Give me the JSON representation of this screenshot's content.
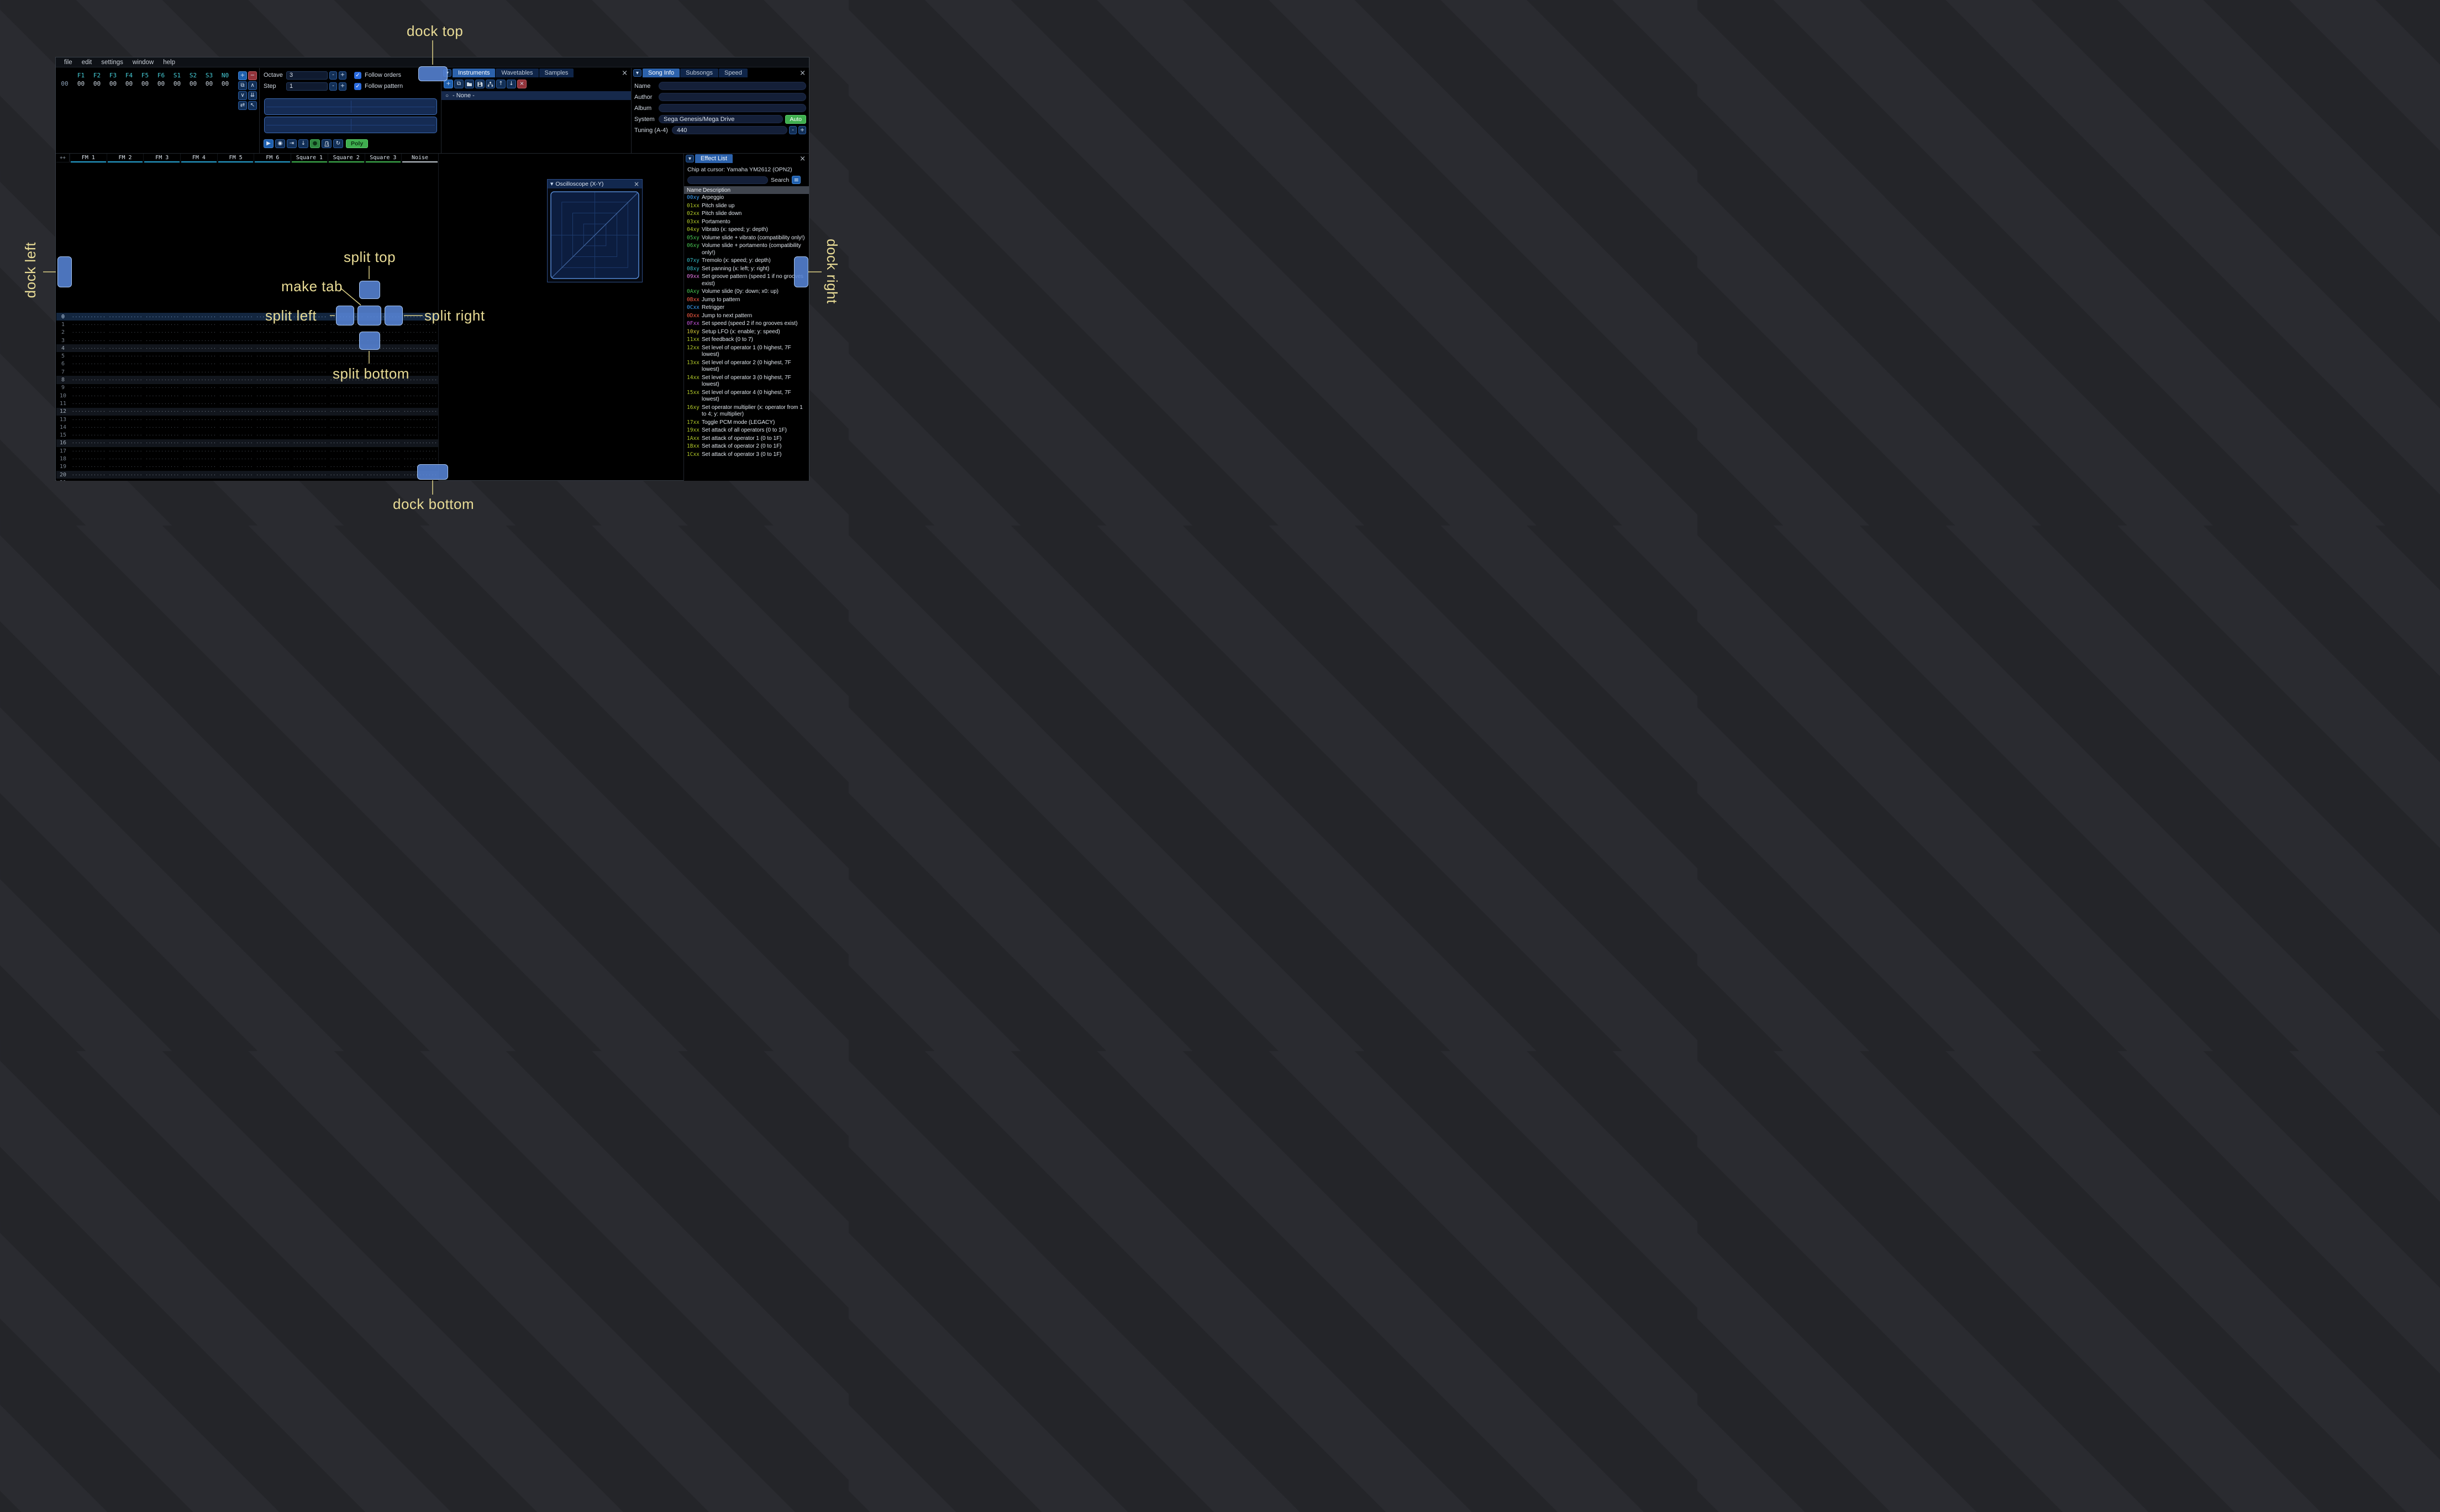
{
  "colors": {
    "accent": "#2c62ac",
    "overlay": "#5a86d4",
    "annotation": "#e9dc96",
    "green": "#3fae4f"
  },
  "ui_glyphs": {
    "dropdown": "▼",
    "close": "×",
    "check": "✓",
    "minus": "-",
    "plus": "+",
    "hamburger": "≡"
  },
  "menu": {
    "items": [
      "file",
      "edit",
      "settings",
      "window",
      "help"
    ]
  },
  "orders": {
    "columns": [
      "F1",
      "F2",
      "F3",
      "F4",
      "F5",
      "F6",
      "S1",
      "S2",
      "S3",
      "N0"
    ],
    "row_index": "00",
    "row_values": [
      "00",
      "00",
      "00",
      "00",
      "00",
      "00",
      "00",
      "00",
      "00",
      "00"
    ],
    "buttons": [
      {
        "name": "add-order-button",
        "glyph": "+",
        "style": "blue"
      },
      {
        "name": "remove-order-button",
        "glyph": "−",
        "style": "red"
      },
      {
        "name": "duplicate-order-button",
        "glyph": "⧉",
        "style": ""
      },
      {
        "name": "move-order-up-button",
        "glyph": "∧",
        "style": ""
      },
      {
        "name": "move-order-down-button",
        "glyph": "∨",
        "style": ""
      },
      {
        "name": "duplicate-order-to-end-button",
        "glyph": "⇊",
        "style": ""
      },
      {
        "name": "order-change-mode-button",
        "glyph": "⇄",
        "style": ""
      },
      {
        "name": "order-edit-cursor-button",
        "glyph": "↖",
        "style": ""
      }
    ]
  },
  "transport": {
    "octave_label": "Octave",
    "octave_value": "3",
    "step_label": "Step",
    "step_value": "1",
    "follow_orders_label": "Follow orders",
    "follow_pattern_label": "Follow pattern",
    "poly_label": "Poly",
    "play_buttons": [
      {
        "name": "play-button",
        "glyph": "▶",
        "style": "blue"
      },
      {
        "name": "play-from-cursor-button",
        "glyph": "◉",
        "style": ""
      },
      {
        "name": "step-one-row-button",
        "glyph": "⇥",
        "style": ""
      },
      {
        "name": "stop-button",
        "glyph": "↓",
        "style": ""
      },
      {
        "name": "edit-toggle-button",
        "glyph": "●",
        "style": "green"
      },
      {
        "name": "metronome-button",
        "glyph": "metronome-icon",
        "style": ""
      },
      {
        "name": "repeat-pattern-button",
        "glyph": "↻",
        "style": ""
      }
    ]
  },
  "instruments": {
    "tabs": [
      {
        "label": "Instruments",
        "active": true
      },
      {
        "label": "Wavetables",
        "active": false
      },
      {
        "label": "Samples",
        "active": false
      }
    ],
    "toolbar": [
      {
        "name": "add-instrument-button",
        "glyph": "+",
        "style": "blue"
      },
      {
        "name": "duplicate-instrument-button",
        "glyph": "⧉",
        "style": ""
      },
      {
        "name": "open-instrument-button",
        "glyph": "folder-icon",
        "style": ""
      },
      {
        "name": "save-instrument-button",
        "glyph": "floppy-icon",
        "style": ""
      },
      {
        "name": "instrument-type-button",
        "glyph": "sitemap-icon",
        "style": ""
      },
      {
        "name": "move-instrument-up-button",
        "glyph": "↑",
        "style": ""
      },
      {
        "name": "move-instrument-down-button",
        "glyph": "↓",
        "style": ""
      },
      {
        "name": "delete-instrument-button",
        "glyph": "×",
        "style": "red"
      }
    ],
    "list": [
      {
        "label": "- None -",
        "selected": true,
        "radio": "○"
      }
    ]
  },
  "song_info": {
    "tabs": [
      {
        "label": "Song Info",
        "active": true
      },
      {
        "label": "Subsongs",
        "active": false
      },
      {
        "label": "Speed",
        "active": false
      }
    ],
    "fields": [
      {
        "label": "Name",
        "value": ""
      },
      {
        "label": "Author",
        "value": ""
      },
      {
        "label": "Album",
        "value": ""
      }
    ],
    "system_label": "System",
    "system_value": "Sega Genesis/Mega Drive",
    "auto_label": "Auto",
    "tuning_label": "Tuning (A-4)",
    "tuning_value": "440"
  },
  "pattern": {
    "corner_label": "++",
    "channel_colors": {
      "fm": "#27a7d7",
      "square": "#43bb52",
      "noise": "#c3cbd3"
    },
    "channels": [
      {
        "name": "FM 1",
        "type": "fm"
      },
      {
        "name": "FM 2",
        "type": "fm"
      },
      {
        "name": "FM 3",
        "type": "fm"
      },
      {
        "name": "FM 4",
        "type": "fm"
      },
      {
        "name": "FM 5",
        "type": "fm"
      },
      {
        "name": "FM 6",
        "type": "fm"
      },
      {
        "name": "Square 1",
        "type": "square"
      },
      {
        "name": "Square 2",
        "type": "square"
      },
      {
        "name": "Square 3",
        "type": "square"
      },
      {
        "name": "Noise",
        "type": "noise"
      }
    ],
    "row_count": 22,
    "empty_cell": "················"
  },
  "oscilloscope": {
    "title": "Oscilloscope (X-Y)"
  },
  "effect_list": {
    "tabs": [
      {
        "label": "Effect List",
        "active": true
      }
    ],
    "chip_line": "Chip at cursor: Yamaha YM2612 (OPN2)",
    "search_value": "",
    "search_label": "Search",
    "col_name": "Name",
    "col_desc": "Description",
    "effects": [
      {
        "code": "00xy",
        "desc": "Arpeggio",
        "color": "#3ca4ff"
      },
      {
        "code": "01xx",
        "desc": "Pitch slide up",
        "color": "#b4cc2a"
      },
      {
        "code": "02xx",
        "desc": "Pitch slide down",
        "color": "#b4cc2a"
      },
      {
        "code": "03xx",
        "desc": "Portamento",
        "color": "#b4cc2a"
      },
      {
        "code": "04xy",
        "desc": "Vibrato (x: speed; y: depth)",
        "color": "#b4cc2a"
      },
      {
        "code": "05xy",
        "desc": "Volume slide + vibrato (compatibility only!)",
        "color": "#49c653"
      },
      {
        "code": "06xy",
        "desc": "Volume slide + portamento (compatibility only!)",
        "color": "#49c653"
      },
      {
        "code": "07xy",
        "desc": "Tremolo (x: speed; y: depth)",
        "color": "#35bdc8"
      },
      {
        "code": "08xy",
        "desc": "Set panning (x: left; y: right)",
        "color": "#35bdc8"
      },
      {
        "code": "09xx",
        "desc": "Set groove pattern (speed 1 if no grooves exist)",
        "color": "#e87ae8"
      },
      {
        "code": "0Axy",
        "desc": "Volume slide (0y: down; x0: up)",
        "color": "#49c653"
      },
      {
        "code": "0Bxx",
        "desc": "Jump to pattern",
        "color": "#ff5f47"
      },
      {
        "code": "0Cxx",
        "desc": "Retrigger",
        "color": "#3ca4ff"
      },
      {
        "code": "0Dxx",
        "desc": "Jump to next pattern",
        "color": "#ff5f47"
      },
      {
        "code": "0Fxx",
        "desc": "Set speed (speed 2 if no grooves exist)",
        "color": "#c957e0"
      },
      {
        "code": "10xy",
        "desc": "Setup LFO (x: enable; y: speed)",
        "color": "#d8ce3a"
      },
      {
        "code": "11xx",
        "desc": "Set feedback (0 to 7)",
        "color": "#b4cc2a"
      },
      {
        "code": "12xx",
        "desc": "Set level of operator 1 (0 highest, 7F lowest)",
        "color": "#b4cc2a"
      },
      {
        "code": "13xx",
        "desc": "Set level of operator 2 (0 highest, 7F lowest)",
        "color": "#b4cc2a"
      },
      {
        "code": "14xx",
        "desc": "Set level of operator 3 (0 highest, 7F lowest)",
        "color": "#b4cc2a"
      },
      {
        "code": "15xx",
        "desc": "Set level of operator 4 (0 highest, 7F lowest)",
        "color": "#b4cc2a"
      },
      {
        "code": "16xy",
        "desc": "Set operator multiplier (x: operator from 1 to 4; y: multiplier)",
        "color": "#b4cc2a"
      },
      {
        "code": "17xx",
        "desc": "Toggle PCM mode (LEGACY)",
        "color": "#b4cc2a"
      },
      {
        "code": "19xx",
        "desc": "Set attack of all operators (0 to 1F)",
        "color": "#b4cc2a"
      },
      {
        "code": "1Axx",
        "desc": "Set attack of operator 1 (0 to 1F)",
        "color": "#b4cc2a"
      },
      {
        "code": "1Bxx",
        "desc": "Set attack of operator 2 (0 to 1F)",
        "color": "#b4cc2a"
      },
      {
        "code": "1Cxx",
        "desc": "Set attack of operator 3 (0 to 1F)",
        "color": "#b4cc2a"
      }
    ]
  },
  "dock_overlay": {
    "labels": {
      "dock_top": "dock top",
      "dock_left": "dock left",
      "dock_right": "dock right",
      "dock_bottom": "dock bottom",
      "split_top": "split top",
      "split_left": "split left",
      "split_right": "split right",
      "split_bottom": "split bottom",
      "make_tab": "make tab"
    }
  }
}
